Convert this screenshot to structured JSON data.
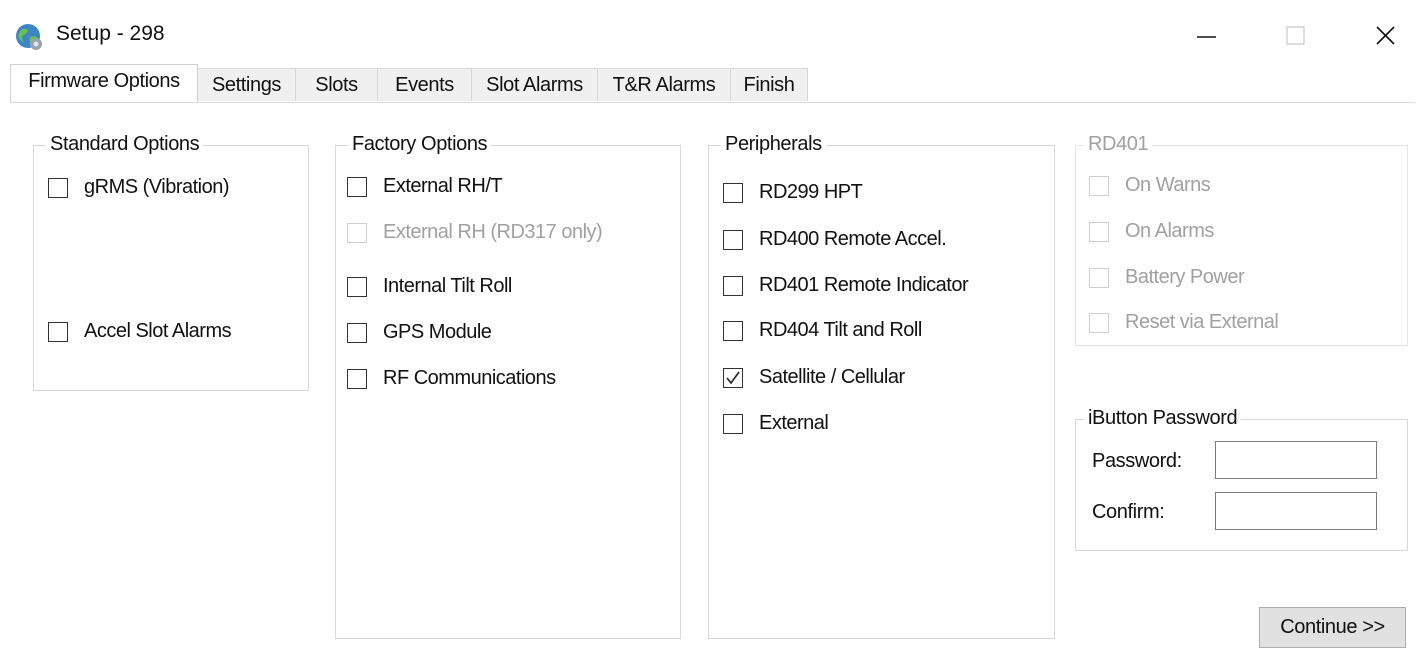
{
  "window": {
    "title": "Setup - 298",
    "controls": {
      "minimize_icon": "minimize-icon",
      "maximize_icon": "maximize-icon",
      "close_icon": "close-icon"
    }
  },
  "tabs": [
    {
      "label": "Firmware Options",
      "active": true
    },
    {
      "label": "Settings",
      "active": false
    },
    {
      "label": "Slots",
      "active": false
    },
    {
      "label": "Events",
      "active": false
    },
    {
      "label": "Slot Alarms",
      "active": false
    },
    {
      "label": "T&R Alarms",
      "active": false
    },
    {
      "label": "Finish",
      "active": false
    }
  ],
  "standard_options": {
    "title": "Standard Options",
    "items": [
      {
        "label": "gRMS (Vibration)",
        "checked": false,
        "enabled": true
      },
      {
        "label": "Accel  Slot Alarms",
        "checked": false,
        "enabled": true
      }
    ]
  },
  "factory_options": {
    "title": "Factory Options",
    "items": [
      {
        "label": "External RH/T",
        "checked": false,
        "enabled": true
      },
      {
        "label": "External RH (RD317 only)",
        "checked": false,
        "enabled": false
      },
      {
        "label": "Internal Tilt  Roll",
        "checked": false,
        "enabled": true
      },
      {
        "label": "GPS Module",
        "checked": false,
        "enabled": true
      },
      {
        "label": "RF Communications",
        "checked": false,
        "enabled": true
      }
    ]
  },
  "peripherals": {
    "title": "Peripherals",
    "items": [
      {
        "label": "RD299 HPT",
        "checked": false,
        "enabled": true
      },
      {
        "label": "RD400 Remote Accel.",
        "checked": false,
        "enabled": true
      },
      {
        "label": "RD401 Remote Indicator",
        "checked": false,
        "enabled": true
      },
      {
        "label": "RD404 Tilt and Roll",
        "checked": false,
        "enabled": true
      },
      {
        "label": "Satellite / Cellular",
        "checked": true,
        "enabled": true
      },
      {
        "label": "External",
        "checked": false,
        "enabled": true
      }
    ]
  },
  "rd401": {
    "title": "RD401",
    "enabled": false,
    "items": [
      {
        "label": "On Warns",
        "checked": false,
        "enabled": false
      },
      {
        "label": "On Alarms",
        "checked": false,
        "enabled": false
      },
      {
        "label": "Battery Power",
        "checked": false,
        "enabled": false
      },
      {
        "label": "Reset via External",
        "checked": false,
        "enabled": false
      }
    ]
  },
  "ibutton": {
    "title": "iButton Password",
    "password_label": "Password:",
    "password_value": "",
    "confirm_label": "Confirm:",
    "confirm_value": ""
  },
  "continue_label": "Continue >>",
  "colors": {
    "check_mark": "#222222",
    "disabled_text": "#a0a0a0",
    "button_face": "#e1e1e1"
  }
}
